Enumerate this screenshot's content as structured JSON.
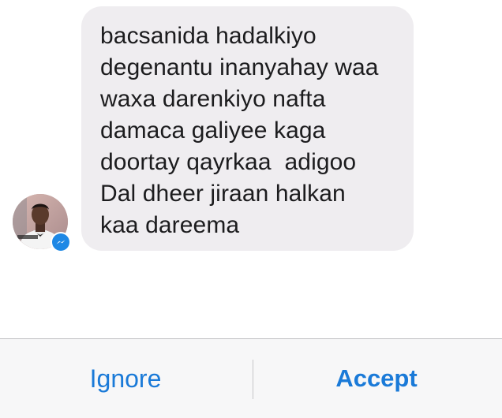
{
  "message": {
    "lines": [
      "bacsanida hadalkiyo",
      "degenantu inanyahay waa",
      "waxa darenkiyo nafta",
      "damaca galiyee kaga",
      "doortay qayrkaa  adigoo",
      "Dal dheer jiraan halkan",
      "kaa dareema"
    ]
  },
  "sender": {
    "avatar_icon": "profile-photo",
    "badge_icon": "messenger-icon"
  },
  "actions": {
    "ignore_label": "Ignore",
    "accept_label": "Accept"
  },
  "colors": {
    "accent": "#1a7ad8",
    "bubble": "#efedf0",
    "messenger_badge": "#1e88e5"
  }
}
